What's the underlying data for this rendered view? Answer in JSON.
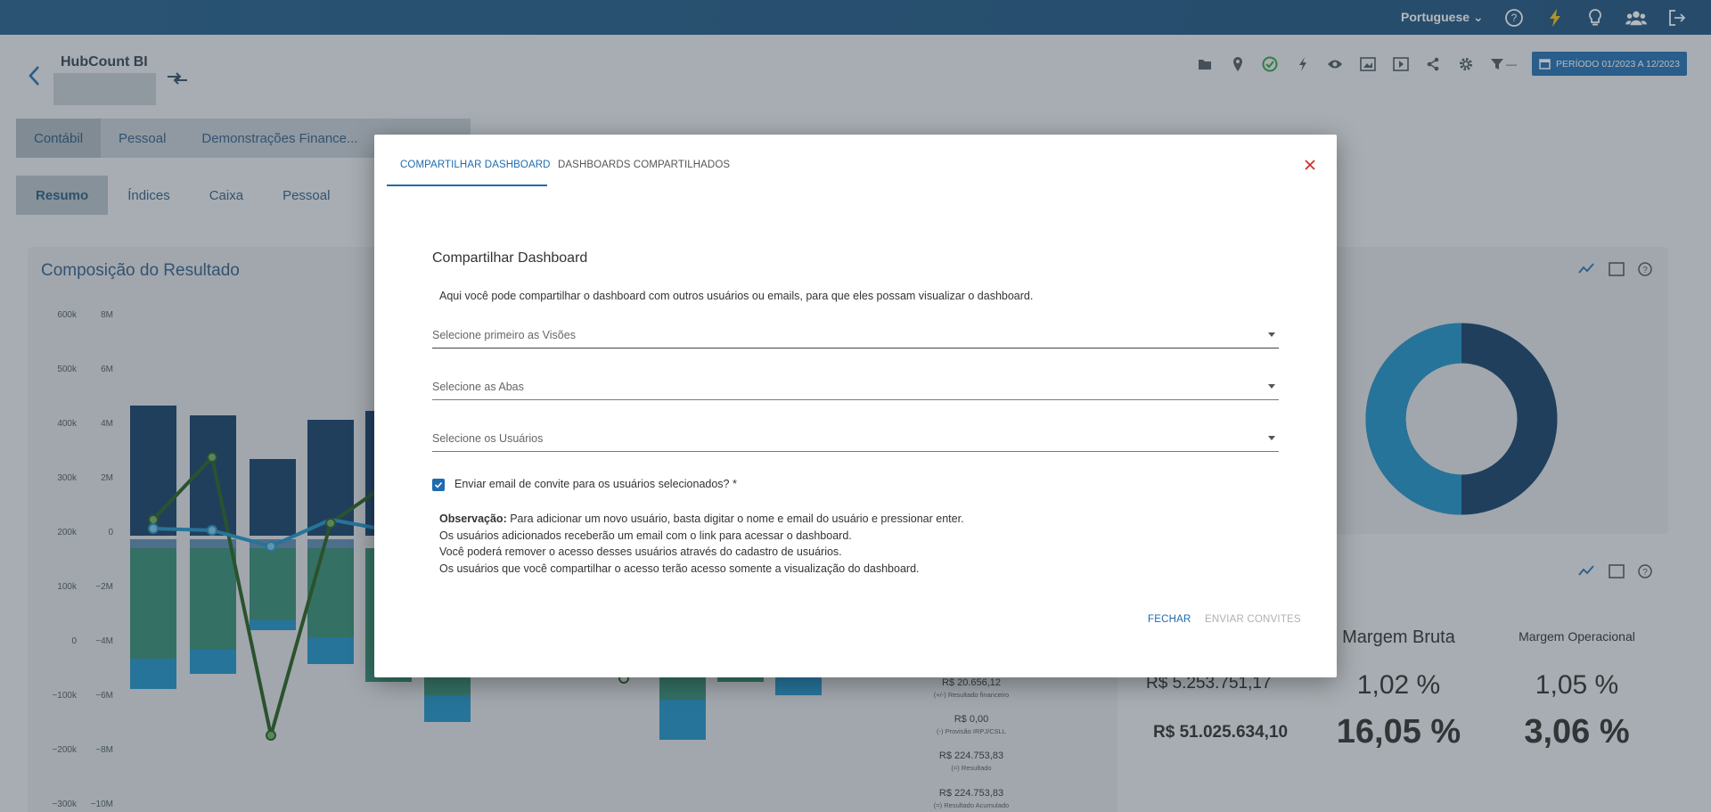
{
  "topbar": {
    "language": "Portuguese",
    "icons": [
      "help-icon",
      "lightning-icon",
      "bulb-icon",
      "users-icon",
      "logout-icon"
    ]
  },
  "header": {
    "title": "HubCount BI",
    "period_label": "PERÍODO 01/2023 A 12/2023",
    "toolbar_icons": [
      "folder-icon",
      "pin-icon",
      "check-circle-icon",
      "bolt-icon",
      "eye-icon",
      "image-icon",
      "play-icon",
      "share-icon",
      "gear-icon",
      "filter-icon"
    ],
    "filter_suffix": "—"
  },
  "tabs_primary": [
    "Contábil",
    "Pessoal",
    "Demonstrações Finance..."
  ],
  "tabs_secondary": [
    "Resumo",
    "Índices",
    "Caixa",
    "Pessoal"
  ],
  "chart_card": {
    "title": "Composição do Resultado",
    "left_axis": [
      "600k",
      "500k",
      "400k",
      "300k",
      "200k",
      "100k",
      "0",
      "−100k",
      "−200k",
      "−300k"
    ],
    "right_axis": [
      "8M",
      "6M",
      "4M",
      "2M",
      "0",
      "−2M",
      "−4M",
      "−6M",
      "−8M",
      "−10M"
    ]
  },
  "legend_values": [
    {
      "value": "R$ 20.656,12",
      "label": "(+/-) Resultado financeiro"
    },
    {
      "value": "R$ 0,00",
      "label": "(-) Provisão IRPJ/CSLL"
    },
    {
      "value": "R$ 224.753,83",
      "label": "(=) Resultado"
    },
    {
      "value": "R$ 224.753,83",
      "label": "(=) Resultado Acumulado"
    }
  ],
  "kpis": [
    {
      "title": "",
      "value": "R$ 5.253.751,17",
      "big": "R$ 51.025.634,10"
    },
    {
      "title": "Margem Bruta",
      "value": "1,02 %",
      "big": "16,05 %"
    },
    {
      "title": "Margem Operacional",
      "value": "1,05 %",
      "big": "3,06 %"
    }
  ],
  "modal": {
    "tab_share": "COMPARTILHAR DASHBOARD",
    "tab_shared": "DASHBOARDS COMPARTILHADOS",
    "heading": "Compartilhar Dashboard",
    "description": "Aqui você pode compartilhar o dashboard com outros usuários ou emails, para que eles possam visualizar o dashboard.",
    "select_views": "Selecione primeiro as Visões",
    "select_tabs": "Selecione as Abas",
    "select_users": "Selecione os Usuários",
    "checkbox_label": "Enviar email de convite para os usuários selecionados? *",
    "note_label": "Observação:",
    "note_line1": "Para adicionar um novo usuário, basta digitar o nome e email do usuário e pressionar enter.",
    "note_line2": "Os usuários adicionados receberão um email com o link para acessar o dashboard.",
    "note_line3": "Você poderá remover o acesso desses usuários através do cadastro de usuários.",
    "note_line4": "Os usuários que você compartilhar o acesso terão acesso somente a visualização do dashboard.",
    "btn_close": "FECHAR",
    "btn_send": "ENVIAR CONVITES"
  }
}
